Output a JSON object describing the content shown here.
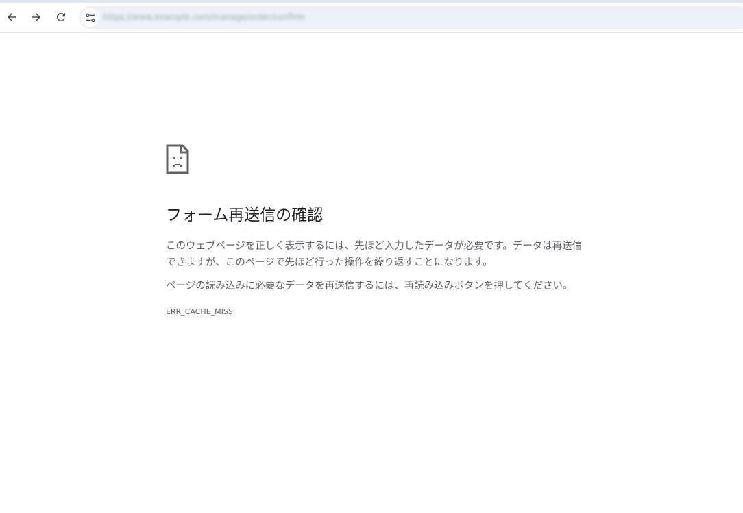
{
  "toolbar": {
    "back_icon": "arrow-left-icon",
    "forward_icon": "arrow-right-icon",
    "reload_icon": "reload-icon",
    "site_info_icon": "tune-icon",
    "url": "https://www.example.com/manage/order/confirm"
  },
  "error_page": {
    "icon": "sad-page-icon",
    "title": "フォーム再送信の確認",
    "paragraph1": "このウェブページを正しく表示するには、先ほど入力したデータが必要です。データは再送信できますが、このページで先ほど行った操作を繰り返すことになります。",
    "paragraph2": "ページの読み込みに必要なデータを再送信するには、再読み込みボタンを押してください。",
    "error_code": "ERR_CACHE_MISS"
  }
}
